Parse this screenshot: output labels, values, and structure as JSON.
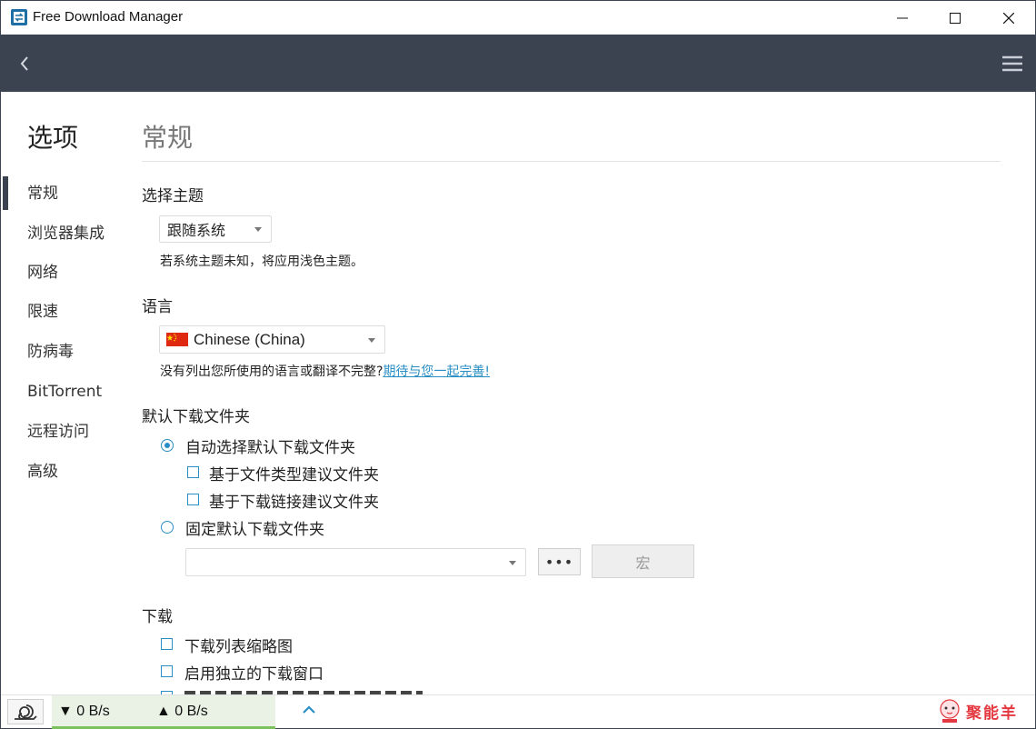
{
  "window": {
    "title": "Free Download Manager"
  },
  "sidebar": {
    "title": "选项",
    "items": [
      {
        "label": "常规",
        "active": true
      },
      {
        "label": "浏览器集成"
      },
      {
        "label": "网络"
      },
      {
        "label": "限速"
      },
      {
        "label": "防病毒"
      },
      {
        "label": "BitTorrent"
      },
      {
        "label": "远程访问"
      },
      {
        "label": "高级"
      }
    ]
  },
  "page": {
    "title": "常规"
  },
  "theme": {
    "label": "选择主题",
    "value": "跟随系统",
    "hint": "若系统主题未知，将应用浅色主题。"
  },
  "language": {
    "label": "语言",
    "value": "Chinese (China)",
    "hint_text": "没有列出您所使用的语言或翻译不完整?",
    "hint_link": "期待与您一起完善!"
  },
  "folder": {
    "label": "默认下载文件夹",
    "auto_option": "自动选择默认下载文件夹",
    "by_type": "基于文件类型建议文件夹",
    "by_link": "基于下载链接建议文件夹",
    "fixed_option": "固定默认下载文件夹",
    "path_value": "",
    "browse_label": "•••",
    "macro_label": "宏"
  },
  "download": {
    "label": "下载",
    "thumbnails": "下载列表缩略图",
    "separate_window": "启用独立的下载窗口"
  },
  "status": {
    "down_speed": "▼ 0 B/s",
    "up_speed": "▲ 0 B/s"
  },
  "watermark": {
    "text": "聚能羊"
  },
  "colors": {
    "accent": "#2a8fc4",
    "header": "#3b4250",
    "speed_bar": "#7bc25f"
  }
}
